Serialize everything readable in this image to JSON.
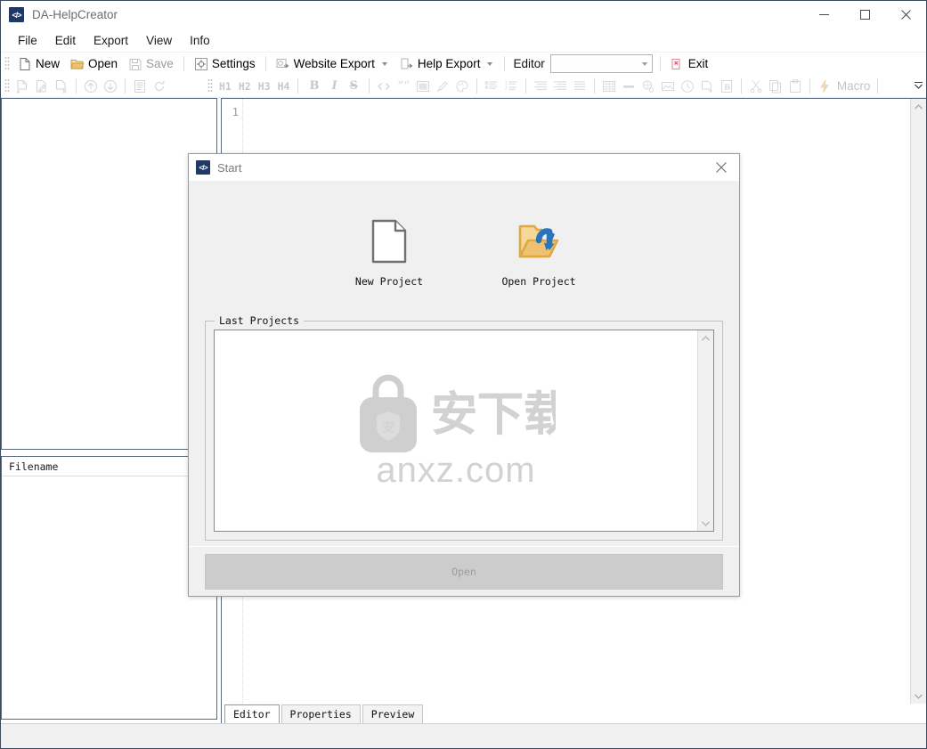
{
  "window": {
    "title": "DA-HelpCreator",
    "icon": "code-tags-icon",
    "minimize": "−",
    "maximize": "▭",
    "close": "✕"
  },
  "menubar": {
    "items": [
      {
        "label": "File",
        "name": "menu-file"
      },
      {
        "label": "Edit",
        "name": "menu-edit"
      },
      {
        "label": "Export",
        "name": "menu-export"
      },
      {
        "label": "View",
        "name": "menu-view"
      },
      {
        "label": "Info",
        "name": "menu-info"
      }
    ]
  },
  "toolbar_main": {
    "new_label": "New",
    "open_label": "Open",
    "save_label": "Save",
    "settings_label": "Settings",
    "website_export_label": "Website Export",
    "help_export_label": "Help Export",
    "editor_label": "Editor",
    "editor_combo_value": "",
    "exit_label": "Exit"
  },
  "toolbar_format": {
    "headings": [
      "H1",
      "H2",
      "H3",
      "H4"
    ],
    "bold": "B",
    "italic": "I",
    "strike": "S",
    "macro_label": "Macro",
    "icons": [
      "add-file-icon",
      "edit-file-icon",
      "delete-file-icon",
      "move-up-icon",
      "move-down-icon",
      "page-properties-icon",
      "refresh-icon",
      "code-icon",
      "quote-icon",
      "box-icon",
      "highlighter-icon",
      "palette-icon",
      "bullet-list-icon",
      "numbered-list-icon",
      "indent-icon",
      "align-right-icon",
      "justify-icon",
      "table-icon",
      "horizontal-rule-icon",
      "link-icon",
      "image-icon",
      "time-icon",
      "new-page-icon",
      "bookmark-icon",
      "cut-icon",
      "copy-icon",
      "paste-icon",
      "macro-icon"
    ],
    "overflow": "toolbar-overflow-icon"
  },
  "left_panel": {
    "tree_placeholder": "",
    "files_header": "Filename"
  },
  "editor": {
    "line_numbers": [
      "1"
    ],
    "content": "",
    "scroll_up": "▲",
    "scroll_down": "▼"
  },
  "bottom_tabs": {
    "items": [
      {
        "label": "Editor",
        "active": true
      },
      {
        "label": "Properties",
        "active": false
      },
      {
        "label": "Preview",
        "active": false
      }
    ]
  },
  "dialog": {
    "title": "Start",
    "icon": "code-tags-icon",
    "close": "✕",
    "actions": [
      {
        "label": "New Project",
        "icon": "new-document-icon"
      },
      {
        "label": "Open Project",
        "icon": "open-folder-icon"
      }
    ],
    "group_legend": "Last Projects",
    "list_items": [],
    "watermark": {
      "logo": "shield-bag-icon",
      "cjk": "安下载",
      "domain": "anxz.com"
    },
    "open_button": {
      "label": "Open",
      "enabled": false
    }
  },
  "colors": {
    "accent_blue": "#1f3864",
    "folder_yellow": "#f0c170",
    "arrow_blue": "#2a74bb",
    "panel_bg": "#f0f0f0",
    "border": "#5b6a7d",
    "disabled_text": "#9d9d9d",
    "watermark_gray": "#d2d2d2"
  }
}
